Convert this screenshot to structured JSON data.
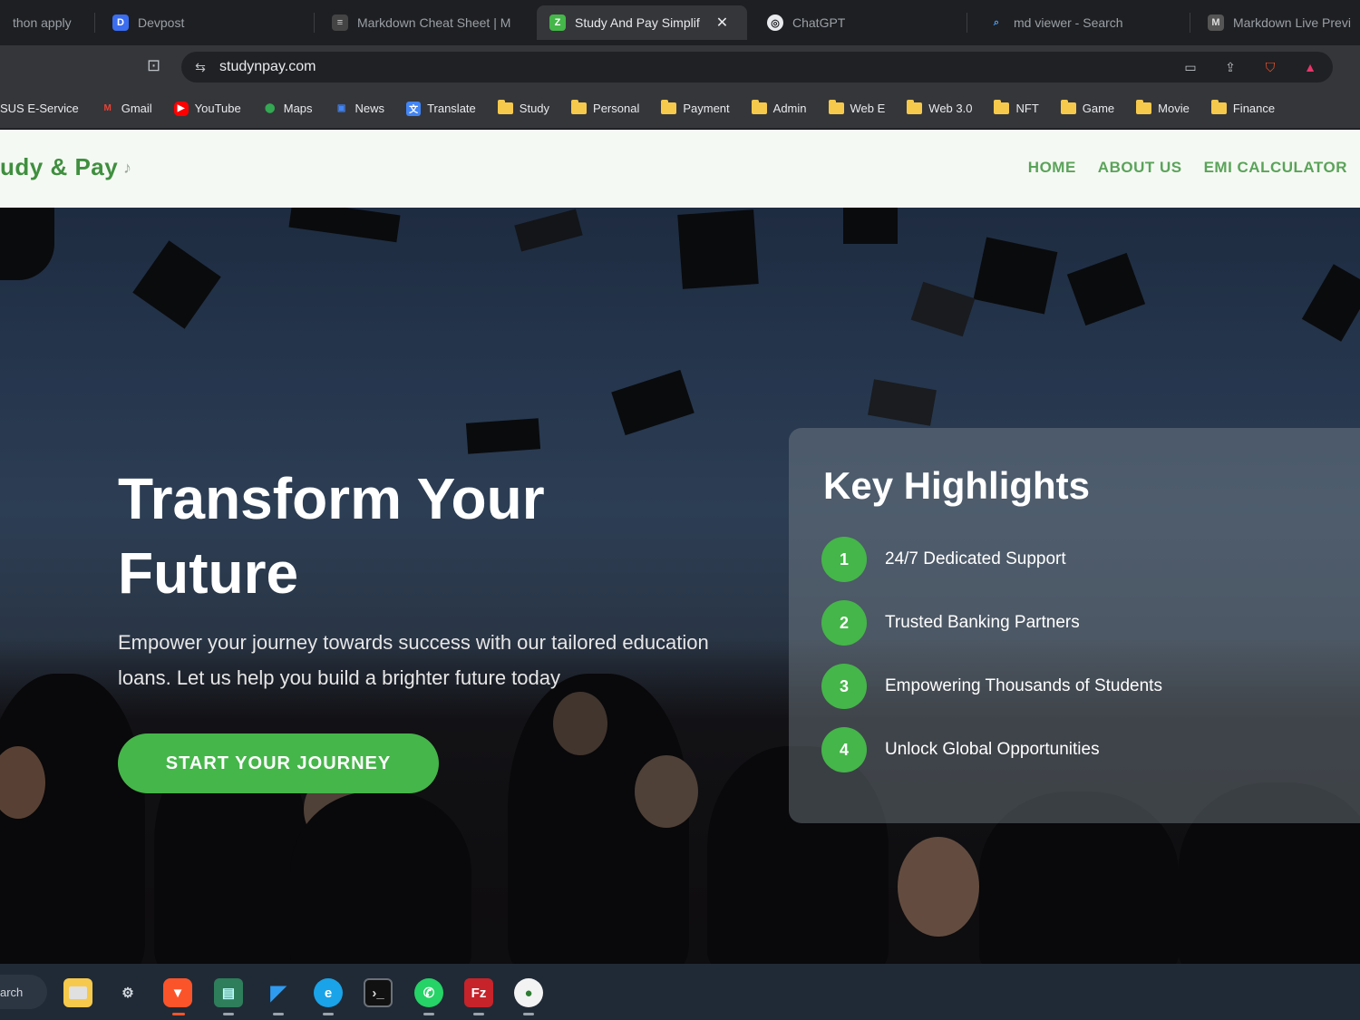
{
  "browser": {
    "tabs": [
      {
        "label": "thon apply",
        "active": false
      },
      {
        "label": "Devpost",
        "active": false
      },
      {
        "label": "Markdown Cheat Sheet | M",
        "active": false
      },
      {
        "label": "Study And Pay Simplif",
        "active": true
      },
      {
        "label": "ChatGPT",
        "active": false
      },
      {
        "label": "md viewer - Search",
        "active": false
      },
      {
        "label": "Markdown Live Previ",
        "active": false
      }
    ],
    "url": "studynpay.com",
    "bookmarks": [
      {
        "label": "SUS E-Service",
        "type": "site"
      },
      {
        "label": "Gmail",
        "type": "site"
      },
      {
        "label": "YouTube",
        "type": "site"
      },
      {
        "label": "Maps",
        "type": "site"
      },
      {
        "label": "News",
        "type": "site"
      },
      {
        "label": "Translate",
        "type": "site"
      },
      {
        "label": "Study",
        "type": "folder"
      },
      {
        "label": "Personal",
        "type": "folder"
      },
      {
        "label": "Payment",
        "type": "folder"
      },
      {
        "label": "Admin",
        "type": "folder"
      },
      {
        "label": "Web E",
        "type": "folder"
      },
      {
        "label": "Web 3.0",
        "type": "folder"
      },
      {
        "label": "NFT",
        "type": "folder"
      },
      {
        "label": "Game",
        "type": "folder"
      },
      {
        "label": "Movie",
        "type": "folder"
      },
      {
        "label": "Finance",
        "type": "folder"
      }
    ]
  },
  "site": {
    "brand": "udy & Pay",
    "nav": [
      "HOME",
      "ABOUT US",
      "EMI CALCULATOR"
    ],
    "hero": {
      "title": "Transform Your Future",
      "subtitle": "Empower your journey towards success with our tailored education loans. Let us help you build a brighter future today",
      "cta": "START YOUR JOURNEY"
    },
    "highlights": {
      "title": "Key Highlights",
      "items": [
        {
          "num": "1",
          "text": "24/7 Dedicated Support"
        },
        {
          "num": "2",
          "text": "Trusted Banking Partners"
        },
        {
          "num": "3",
          "text": "Empowering Thousands of Students"
        },
        {
          "num": "4",
          "text": "Unlock Global Opportunities"
        }
      ]
    }
  },
  "taskbar": {
    "search_label": "arch",
    "apps": [
      "file-manager",
      "settings",
      "brave",
      "screen-app",
      "vscode",
      "edge",
      "terminal",
      "whatsapp",
      "filezilla",
      "maps-pin"
    ]
  },
  "colors": {
    "accent_green": "#45b649",
    "brand_green": "#3f8f3f",
    "chrome_dark": "#35363a"
  }
}
